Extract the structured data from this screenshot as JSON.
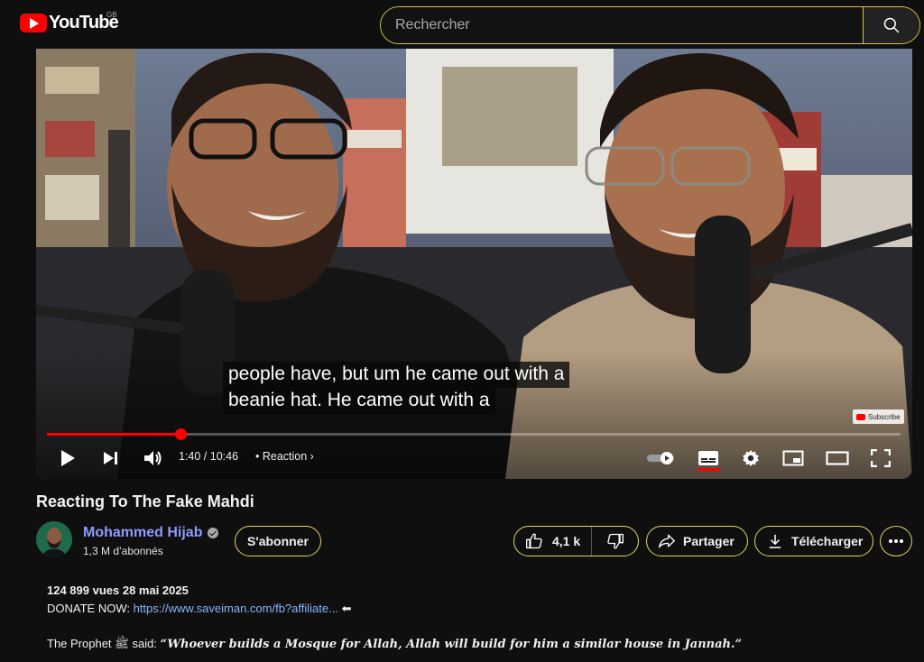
{
  "header": {
    "logo_text": "YouTube",
    "region": "GB",
    "search_placeholder": "Rechercher"
  },
  "player": {
    "caption_lines": [
      "people have, but um he came out with a",
      "beanie hat. He came out with a"
    ],
    "watermark_label": "Subscribe",
    "progress_fraction": 0.156,
    "time_display": "1:40 / 10:46",
    "chapter_label": "Reaction"
  },
  "video": {
    "title": "Reacting To The Fake Mahdi"
  },
  "channel": {
    "name": "Mohammed Hijab",
    "subscribers": "1,3 M d’abonnés"
  },
  "actions": {
    "subscribe": "S'abonner",
    "likes": "4,1 k",
    "share": "Partager",
    "download": "Télécharger"
  },
  "description": {
    "stats": "124 899 vues  28 mai 2025",
    "donate_prefix": "DONATE NOW: ",
    "donate_link": "https://www.saveiman.com/fb?affiliate...",
    "donate_arrow": " ⬅",
    "quote_prefix": "The Prophet ﷺ said: ",
    "quote_text": "“Whoever builds a Mosque for Allah, Allah will build for him a similar house in Jannah.”"
  },
  "colors": {
    "accent_red": "#ff0000",
    "button_outline": "#e8d36a",
    "channel_name": "#8f9bff",
    "link": "#8ab4f8"
  }
}
